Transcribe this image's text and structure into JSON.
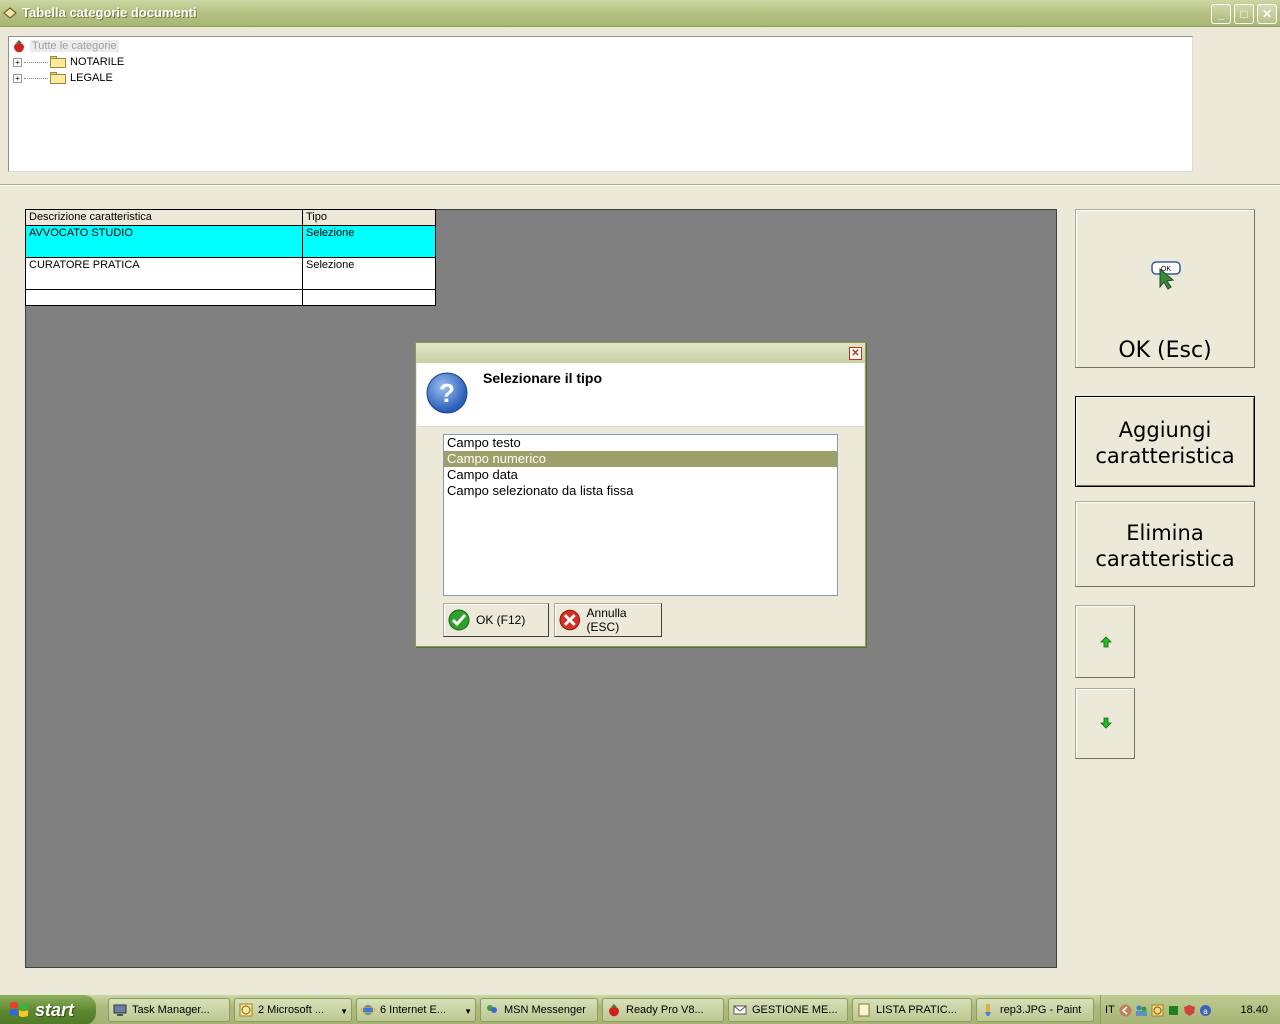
{
  "window": {
    "title": "Tabella categorie documenti"
  },
  "tree": {
    "root": "Tutte le categorie",
    "items": [
      "NOTARILE",
      "LEGALE"
    ]
  },
  "grid": {
    "headers": [
      "Descrizione caratteristica",
      "Tipo"
    ],
    "rows": [
      {
        "descrizione": "AVVOCATO STUDIO",
        "tipo": "Selezione"
      },
      {
        "descrizione": "CURATORE PRATICA",
        "tipo": "Selezione"
      }
    ]
  },
  "buttons": {
    "ok": "OK (Esc)",
    "add_line1": "Aggiungi",
    "add_line2": "caratteristica",
    "del_line1": "Elimina",
    "del_line2": "caratteristica"
  },
  "dialog": {
    "heading": "Selezionare il tipo",
    "options": [
      "Campo testo",
      "Campo numerico",
      "Campo data",
      "Campo selezionato da lista fissa"
    ],
    "selected_index": 1,
    "ok_label": "OK (F12)",
    "cancel_label": "Annulla (ESC)"
  },
  "taskbar": {
    "start": "start",
    "tasks": [
      {
        "label": "Task Manager..."
      },
      {
        "label": "2 Microsoft ..."
      },
      {
        "label": "6 Internet E..."
      },
      {
        "label": "MSN Messenger"
      },
      {
        "label": "Ready Pro V8..."
      },
      {
        "label": "GESTIONE ME..."
      },
      {
        "label": "LISTA PRATIC..."
      },
      {
        "label": "rep3.JPG - Paint"
      }
    ],
    "lang": "IT",
    "clock": "18.40"
  },
  "colors": {
    "selected_row": "#00FFFF",
    "workspace": "#808080",
    "list_selection": "#9EA06A"
  }
}
